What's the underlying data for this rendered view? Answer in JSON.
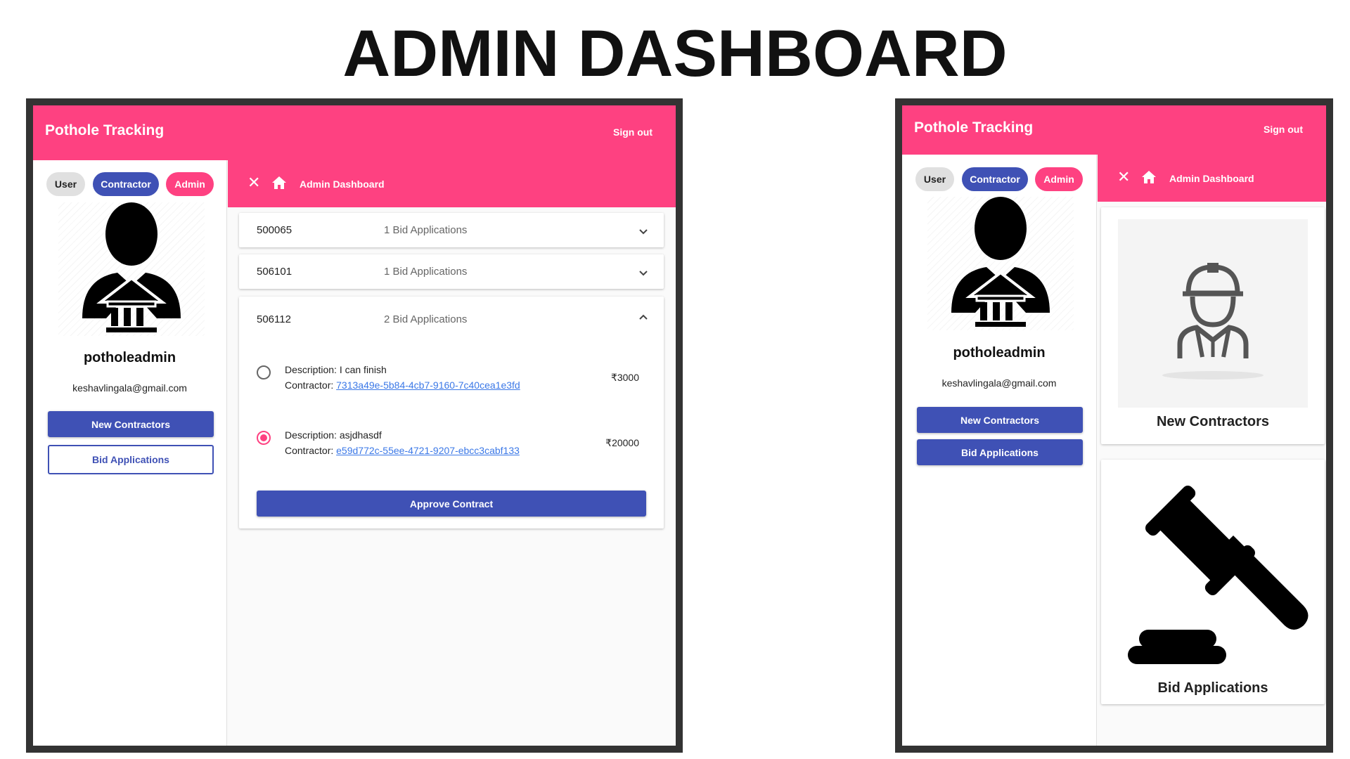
{
  "page": {
    "title": "ADMIN DASHBOARD"
  },
  "colors": {
    "primary_pink": "#fe4181",
    "indigo": "#3f51b5",
    "link_blue": "#3b78e7",
    "frame": "#333333"
  },
  "app": {
    "title": "Pothole Tracking",
    "signout_label": "Sign out"
  },
  "sidebar": {
    "chips": {
      "user": "User",
      "contractor": "Contractor",
      "admin": "Admin"
    },
    "avatar_icon": "admin-user-bank-icon",
    "username": "potholeadmin",
    "email": "keshavlingala@gmail.com",
    "buttons": {
      "new_contractors": "New Contractors",
      "bid_applications": "Bid Applications"
    }
  },
  "subbar": {
    "title": "Admin Dashboard",
    "close_icon": "close-icon",
    "home_icon": "home-icon"
  },
  "pincodes": [
    {
      "pincode": "500065",
      "count": "1 Bid Applications",
      "expanded": false
    },
    {
      "pincode": "506101",
      "count": "1 Bid Applications",
      "expanded": false
    },
    {
      "pincode": "506112",
      "count": "2 Bid Applications",
      "expanded": true,
      "bids": [
        {
          "description_label": "Description:",
          "description": "I can finish",
          "contractor_label": "Contractor:",
          "contractor_id": "7313a49e-5b84-4cb7-9160-7c40cea1e3fd",
          "amount": "₹3000",
          "selected": false
        },
        {
          "description_label": "Description:",
          "description": "asjdhasdf",
          "contractor_label": "Contractor:",
          "contractor_id": "e59d772c-55ee-4721-9207-ebcc3cabf133",
          "amount": "₹20000",
          "selected": true
        }
      ],
      "approve_label": "Approve Contract"
    }
  ],
  "cards": [
    {
      "label": "New Contractors",
      "icon": "construction-worker-icon"
    },
    {
      "label": "Bid Applications",
      "icon": "gavel-icon"
    }
  ]
}
